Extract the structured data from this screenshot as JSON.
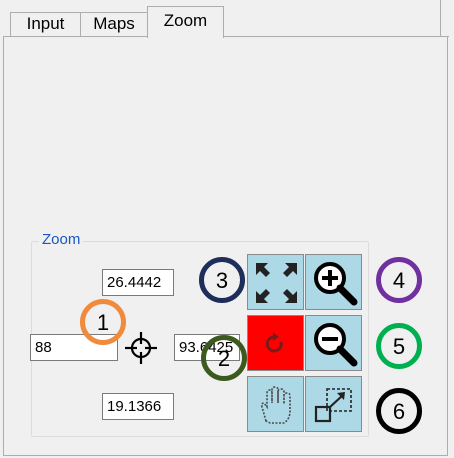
{
  "tabs": [
    {
      "label": "Input",
      "active": false
    },
    {
      "label": "Maps",
      "active": false
    },
    {
      "label": "Zoom",
      "active": true
    }
  ],
  "zoom_group": {
    "title": "Zoom",
    "north_value": "26.4442",
    "west_value": "88",
    "east_value": "93.6425",
    "south_value": "19.1366"
  },
  "buttons": [
    {
      "name": "zoom-full-extent-button",
      "icon": "expand-arrows-icon",
      "color": "#add8e6"
    },
    {
      "name": "zoom-in-button",
      "icon": "magnifier-plus-icon",
      "color": "#add8e6"
    },
    {
      "name": "refresh-button",
      "icon": "refresh-icon",
      "color": "#ff0000"
    },
    {
      "name": "zoom-out-button",
      "icon": "magnifier-minus-icon",
      "color": "#add8e6"
    },
    {
      "name": "pan-button",
      "icon": "hand-icon",
      "color": "#add8e6"
    },
    {
      "name": "zoom-box-button",
      "icon": "zoom-box-icon",
      "color": "#add8e6"
    }
  ],
  "markers": [
    {
      "label": "1",
      "color": "#f08a3c"
    },
    {
      "label": "2",
      "color": "#3d5a1e"
    },
    {
      "label": "3",
      "color": "#1f2d5a"
    },
    {
      "label": "4",
      "color": "#7030a0"
    },
    {
      "label": "5",
      "color": "#00b050"
    },
    {
      "label": "6",
      "color": "#000000"
    }
  ]
}
